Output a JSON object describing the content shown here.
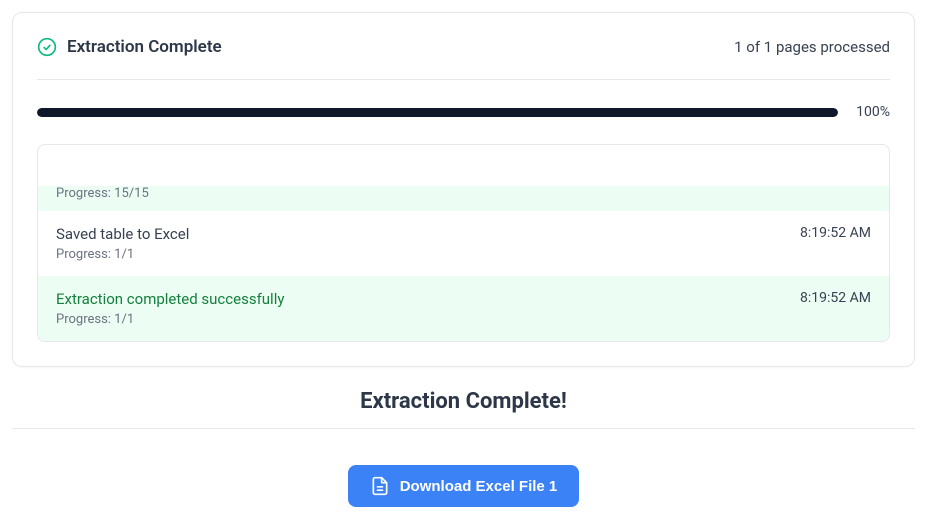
{
  "header": {
    "title": "Extraction Complete",
    "pages_text": "1 of 1 pages processed"
  },
  "progress": {
    "percent_text": "100%"
  },
  "logs": {
    "item0": {
      "progress": "Progress: 15/15"
    },
    "item1": {
      "title": "Saved table to Excel",
      "progress": "Progress: 1/1",
      "time": "8:19:52 AM"
    },
    "item2": {
      "title": "Extraction completed successfully",
      "progress": "Progress: 1/1",
      "time": "8:19:52 AM"
    }
  },
  "complete": {
    "heading": "Extraction Complete!",
    "download_label": "Download Excel File 1"
  }
}
